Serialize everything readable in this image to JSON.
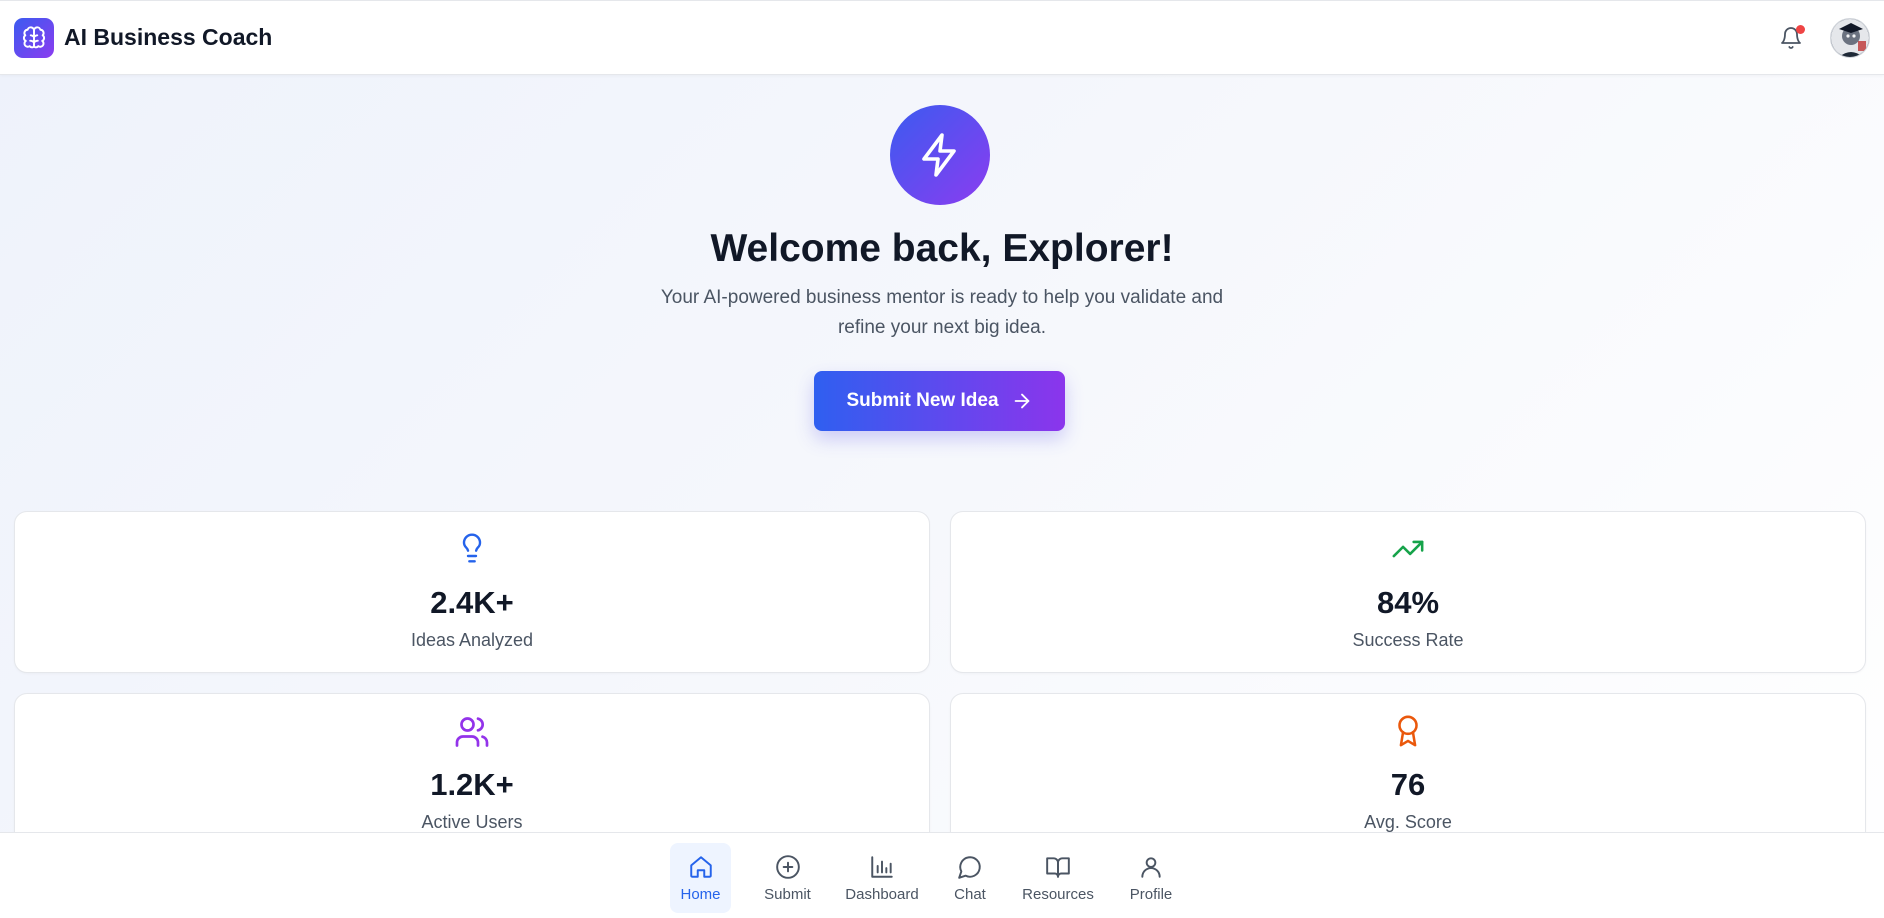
{
  "app": {
    "title": "AI Business Coach"
  },
  "header": {
    "notification_has_unread": true
  },
  "hero": {
    "title": "Welcome back, Explorer!",
    "subtitle": "Your AI-powered business mentor is ready to help you validate and refine your next big idea.",
    "cta_label": "Submit New Idea"
  },
  "stats": [
    {
      "value": "2.4K+",
      "label": "Ideas Analyzed",
      "icon": "lightbulb-icon",
      "color": "#2563eb"
    },
    {
      "value": "84%",
      "label": "Success Rate",
      "icon": "trending-up-icon",
      "color": "#16a34a"
    },
    {
      "value": "1.2K+",
      "label": "Active Users",
      "icon": "users-icon",
      "color": "#9333ea"
    },
    {
      "value": "76",
      "label": "Avg. Score",
      "icon": "award-icon",
      "color": "#ea580c"
    }
  ],
  "nav": {
    "items": [
      {
        "label": "Home",
        "icon": "home-icon",
        "active": true
      },
      {
        "label": "Submit",
        "icon": "plus-circle-icon",
        "active": false
      },
      {
        "label": "Dashboard",
        "icon": "bar-chart-icon",
        "active": false
      },
      {
        "label": "Chat",
        "icon": "message-circle-icon",
        "active": false
      },
      {
        "label": "Resources",
        "icon": "book-open-icon",
        "active": false
      },
      {
        "label": "Profile",
        "icon": "user-icon",
        "active": false
      }
    ]
  },
  "colors": {
    "brand_gradient_start": "#3b5bf0",
    "brand_gradient_end": "#8b3cf0",
    "accent": "#2563eb",
    "notification_dot": "#ef4444"
  }
}
